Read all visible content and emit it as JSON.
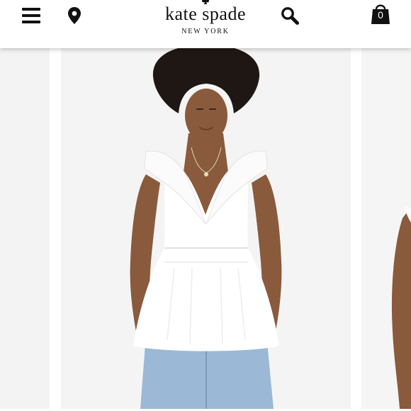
{
  "header": {
    "brand_name": "kate spade",
    "brand_city": "NEW YORK",
    "bag_count": "0",
    "icons": {
      "menu": "hamburger-menu-icon",
      "location": "map-pin-icon",
      "search": "search-icon",
      "bag": "shopping-bag-icon",
      "logo_mark": "spade-icon"
    }
  },
  "carousel": {
    "slides": [
      "previous-product-image",
      "main-product-image",
      "next-product-image"
    ]
  },
  "colors": {
    "icon": "#111111",
    "slide_background": "#f4f4f4",
    "top": "#ffffff",
    "denim": "#9bb8d6",
    "skin": "#8a5a3c"
  }
}
